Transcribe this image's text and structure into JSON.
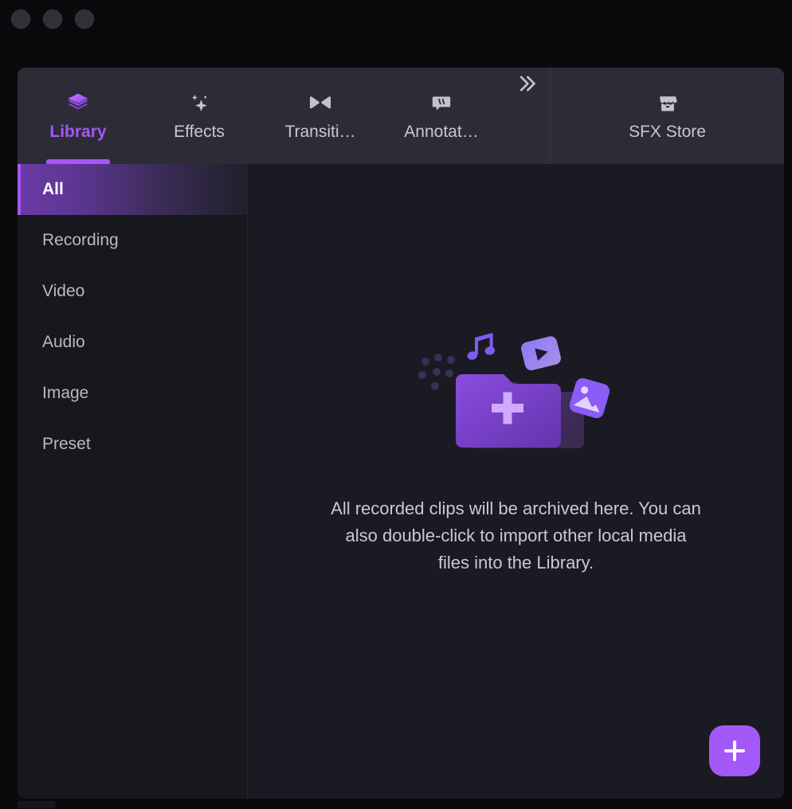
{
  "window": {
    "controls": [
      "close-dot",
      "minimize-dot",
      "maximize-dot"
    ]
  },
  "tabbar": {
    "tabs": [
      {
        "label": "Library",
        "icon": "layers-icon",
        "active": true
      },
      {
        "label": "Effects",
        "icon": "sparkles-icon",
        "active": false
      },
      {
        "label": "Transiti…",
        "icon": "transition-icon",
        "active": false
      },
      {
        "label": "Annotat…",
        "icon": "speech-bubble-icon",
        "active": false
      }
    ],
    "overflow": {
      "label": "»",
      "icon": "double-chevron-right-icon"
    },
    "store_tab": {
      "label": "SFX Store",
      "icon": "store-icon"
    }
  },
  "sidebar": {
    "items": [
      {
        "label": "All",
        "active": true
      },
      {
        "label": "Recording",
        "active": false
      },
      {
        "label": "Video",
        "active": false
      },
      {
        "label": "Audio",
        "active": false
      },
      {
        "label": "Image",
        "active": false
      },
      {
        "label": "Preset",
        "active": false
      }
    ]
  },
  "content": {
    "illustration": "empty-library-folder-illustration",
    "empty_message": "All recorded clips will be archived here. You can also double-click to import other local media files into the Library.",
    "add_button": {
      "label": "+",
      "icon": "plus-icon"
    }
  },
  "colors": {
    "accent": "#a855f7",
    "fab": "#a259f7",
    "panel_bg": "#1a1a22",
    "tabbar_bg": "#2c2c36",
    "sidebar_bg": "#17171e",
    "window_bg": "#0a0a0d",
    "text_primary": "#c9c9d2",
    "text_active": "#ffffff"
  }
}
